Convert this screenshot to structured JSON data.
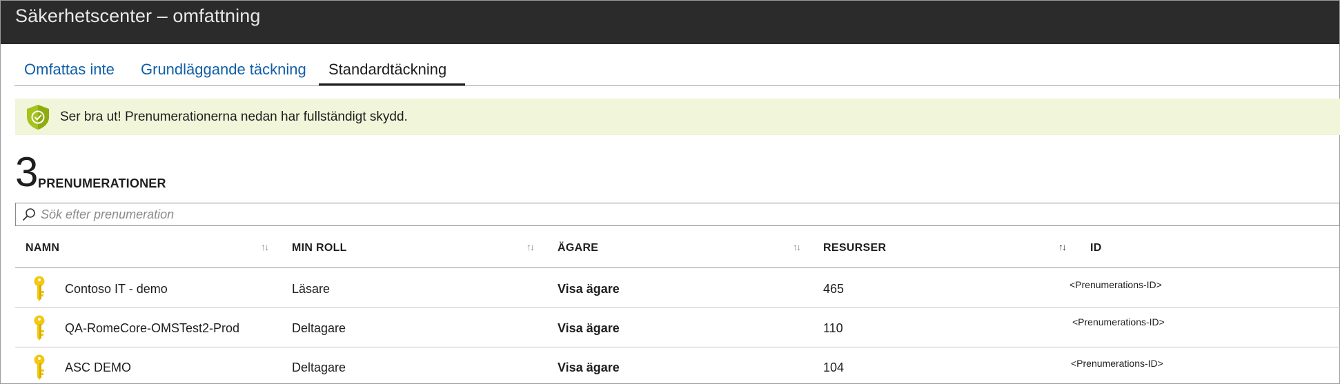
{
  "window": {
    "title": "Säkerhetscenter – omfattning"
  },
  "tabs": [
    {
      "label": "Omfattas inte",
      "selected": false
    },
    {
      "label": "Grundläggande täckning",
      "selected": false
    },
    {
      "label": "Standardtäckning",
      "selected": true
    }
  ],
  "banner": {
    "icon": "shield-check-icon",
    "message": "Ser bra ut! Prenumerationerna nedan har fullständigt skydd."
  },
  "summary": {
    "count": "3",
    "label": "PRENUMERATIONER"
  },
  "search": {
    "placeholder": "Sök efter prenumeration",
    "value": ""
  },
  "table": {
    "columns": [
      "NAMN",
      "MIN ROLL",
      "ÄGARE",
      "RESURSER",
      "ID"
    ],
    "sort_icons": [
      "↑↓",
      "↑↓",
      "↑↓",
      "↑↓"
    ],
    "rows": [
      {
        "icon": "key-icon",
        "name": "Contoso IT - demo",
        "role": "Läsare",
        "owner": "Visa ägare",
        "resources": "465",
        "id": "<Prenumerations-ID>"
      },
      {
        "icon": "key-icon",
        "name": "QA-RomeCore-OMSTest2-Prod",
        "role": "Deltagare",
        "owner": "Visa ägare",
        "resources": "110",
        "id": "<Prenumerations-ID>"
      },
      {
        "icon": "key-icon",
        "name": "ASC DEMO",
        "role": "Deltagare",
        "owner": "Visa ägare",
        "resources": "104",
        "id": "<Prenumerations-ID>"
      }
    ]
  },
  "colors": {
    "titlebar": "#2b2b2b",
    "link": "#0f5ea8",
    "banner_bg": "#f1f5d9",
    "shield": "#a5c21d",
    "key": "#f2c811"
  }
}
